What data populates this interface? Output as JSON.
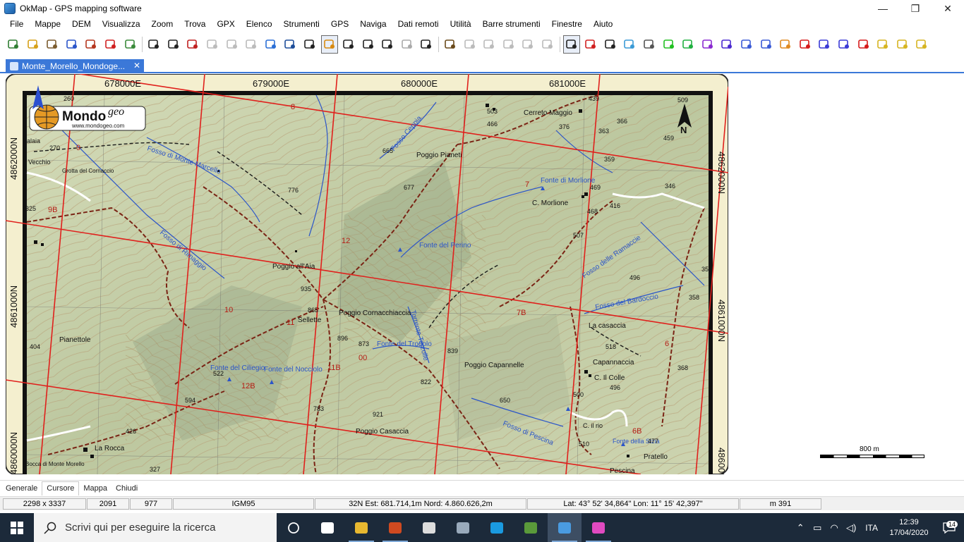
{
  "window": {
    "title": "OkMap - GPS mapping software",
    "controls": {
      "minimize": "—",
      "maximize": "❐",
      "close": "✕"
    }
  },
  "menu": [
    "File",
    "Mappe",
    "DEM",
    "Visualizza",
    "Zoom",
    "Trova",
    "GPX",
    "Elenco",
    "Strumenti",
    "GPS",
    "Naviga",
    "Dati remoti",
    "Utilità",
    "Barre strumenti",
    "Finestre",
    "Aiuto"
  ],
  "toolbar_icons": [
    "open-map-icon",
    "open-folder-icon",
    "open-car-icon",
    "open-bike-icon",
    "open-walk-icon",
    "open-red-icon",
    "open-plus-icon",
    "save-icon",
    "save-as-icon",
    "save-close-icon",
    "save-disabled-icon",
    "print-disabled-icon",
    "print-preview-disabled-icon",
    "map-info-icon",
    "layers-icon",
    "zoom-icon",
    "lock-icon",
    "zoom-in-icon",
    "zoom-out-icon",
    "zoom-window-icon",
    "zoom-previous-icon",
    "zoom-1to1-icon",
    "edit-pencil-icon",
    "edit-disabled-icon",
    "edit-disabled-2-icon",
    "edit-disabled-3-icon",
    "edit-disabled-4-icon",
    "edit-disabled-5-icon",
    "select-arrow-icon",
    "add-point-icon",
    "select-area-icon",
    "eraser-icon",
    "move-icon",
    "smiley-waypoint-icon",
    "route-icon",
    "track-dots-icon",
    "track-circle-icon",
    "polygon-icon",
    "polygon-2-icon",
    "polygon-3-icon",
    "diamond-icon",
    "node-edit-icon",
    "node-insert-icon",
    "node-delete-icon",
    "ruler-icon",
    "ruler-2-icon",
    "ruler-3-icon"
  ],
  "doc_tab": {
    "label": "Monte_Morello_Mondoge...",
    "close": "✕"
  },
  "map": {
    "top_eastings": [
      "678000E",
      "679000E",
      "680000E",
      "681000E"
    ],
    "left_northings": [
      "4862000N",
      "4861000N",
      "4860000N"
    ],
    "right_northings": [
      "4862000N",
      "4861000N",
      "4860000N"
    ],
    "north_arrow_label": "N",
    "logo": {
      "brand": "Mondo",
      "brand_suffix": "geo",
      "url": "www.mondogeo.com"
    },
    "place_names": [
      "Cerreto Maggio",
      "Poggio Pianeti",
      "Fonte di Morlione",
      "C. Morlione",
      "Fonte del Perino",
      "Poggio all'Aia",
      "Poggio Cornacchiaccia",
      "Sellette",
      "Fonte del Trogolo",
      "Poggio Capannelle",
      "Fonte del Ciliegio",
      "Fonte del Nocciolo",
      "Poggio Casaccia",
      "La casaccia",
      "Capannaccia",
      "C. Il Colle",
      "Fosso di Pescina",
      "Pratello",
      "Pescina",
      "Fosso delle Ramaccie",
      "Fosso del Bardoccio",
      "Pianettole",
      "La Rocca",
      "Bocca di Monte Morello",
      "Fosso di Rimaggio",
      "Fosso di Monte Marcello",
      "Fosso Ceppia",
      "Torrente Terzolle",
      "Grotta del Cornaccio",
      "Vecchio",
      "alaia",
      "C. il rio",
      "Fonte della Sizia"
    ],
    "elevations": [
      "260",
      "270",
      "325",
      "404",
      "426",
      "327",
      "594",
      "522",
      "783",
      "921",
      "776",
      "665",
      "677",
      "935",
      "865",
      "896",
      "873",
      "822",
      "839",
      "650",
      "503",
      "466",
      "376",
      "439",
      "363",
      "366",
      "509",
      "459",
      "359",
      "346",
      "469",
      "416",
      "468",
      "507",
      "496",
      "358",
      "518",
      "496",
      "500",
      "510",
      "477",
      "368",
      "35"
    ],
    "trail_numbers": [
      "9",
      "9B",
      "10",
      "11",
      "11B",
      "12",
      "12B",
      "7B",
      "7",
      "6",
      "6B",
      "8",
      "00"
    ],
    "scale": "800 m"
  },
  "bottom_tabs": [
    "Generale",
    "Cursore",
    "Mappa",
    "Chiudi"
  ],
  "active_bottom_tab": "Cursore",
  "status": {
    "image_size": "2298 x 3337",
    "px_x": "2091",
    "px_y": "977",
    "datum": "IGM95",
    "utm": "32N  Est: 681.714,1m  Nord: 4.860.626,2m",
    "latlon": "Lat: 43° 52' 34,864\"  Lon: 11° 15' 42,397\"",
    "elevation": "m 391"
  },
  "taskbar": {
    "search_placeholder": "Scrivi qui per eseguire la ricerca",
    "apps": [
      "task-view-icon",
      "file-explorer-icon",
      "powerpoint-icon",
      "calculator-icon",
      "steam-icon",
      "skype-icon",
      "notepad-icon",
      "okmap-icon",
      "color-app-icon"
    ],
    "lang": "ITA",
    "time": "12:39",
    "date": "17/04/2020",
    "notifications": "14"
  },
  "colors": {
    "accent": "#3b78d8",
    "map_bg": "#c8d2ad",
    "grid_red": "#e0201c",
    "water_blue": "#2b55c9",
    "trail": "#7a2415"
  }
}
